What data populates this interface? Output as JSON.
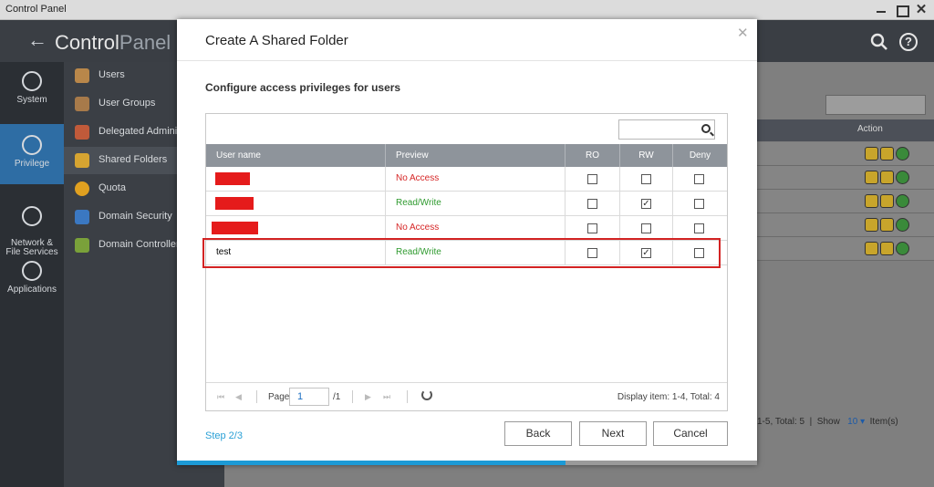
{
  "window": {
    "title": "Control Panel"
  },
  "app": {
    "brand_bold": "Control",
    "brand_light": "Panel"
  },
  "rail": [
    {
      "label": "System",
      "icon": "gear-icon"
    },
    {
      "label": "Privilege",
      "icon": "user-icon"
    },
    {
      "label": "Network &\nFile Services",
      "icon": "globe-icon"
    },
    {
      "label": "Applications",
      "icon": "apps-icon"
    }
  ],
  "submenu": [
    {
      "label": "Users",
      "color": "#b9874a"
    },
    {
      "label": "User Groups",
      "color": "#a77a4a"
    },
    {
      "label": "Delegated Administration",
      "color": "#c05a3a"
    },
    {
      "label": "Shared Folders",
      "color": "#d6a431"
    },
    {
      "label": "Quota",
      "color": "#e0a020"
    },
    {
      "label": "Domain Security",
      "color": "#3b78c2"
    },
    {
      "label": "Domain Controller",
      "color": "#7aa13a"
    }
  ],
  "background": {
    "action_header": "Action",
    "footer_items": "1-5, Total: 5",
    "footer_show": "Show",
    "footer_count": "10",
    "footer_unit": "Item(s)"
  },
  "modal": {
    "title": "Create A Shared Folder",
    "subtitle": "Configure access privileges for users",
    "columns": {
      "user": "User name",
      "preview": "Preview",
      "ro": "RO",
      "rw": "RW",
      "deny": "Deny"
    },
    "rows": [
      {
        "user": "",
        "preview": "No Access",
        "status": "noaccess",
        "ro": false,
        "rw": false,
        "deny": false
      },
      {
        "user": "",
        "preview": "Read/Write",
        "status": "readwrite",
        "ro": false,
        "rw": true,
        "deny": false
      },
      {
        "user": "",
        "preview": "No Access",
        "status": "noaccess",
        "ro": false,
        "rw": false,
        "deny": false
      },
      {
        "user": "test",
        "preview": "Read/Write",
        "status": "readwrite",
        "ro": false,
        "rw": true,
        "deny": false
      }
    ],
    "pager": {
      "page_label": "Page",
      "page_value": "1",
      "page_total": "/1",
      "display": "Display item: 1-4, Total: 4"
    },
    "step": "Step 2/3",
    "buttons": {
      "back": "Back",
      "next": "Next",
      "cancel": "Cancel"
    },
    "progress": 0.67
  }
}
